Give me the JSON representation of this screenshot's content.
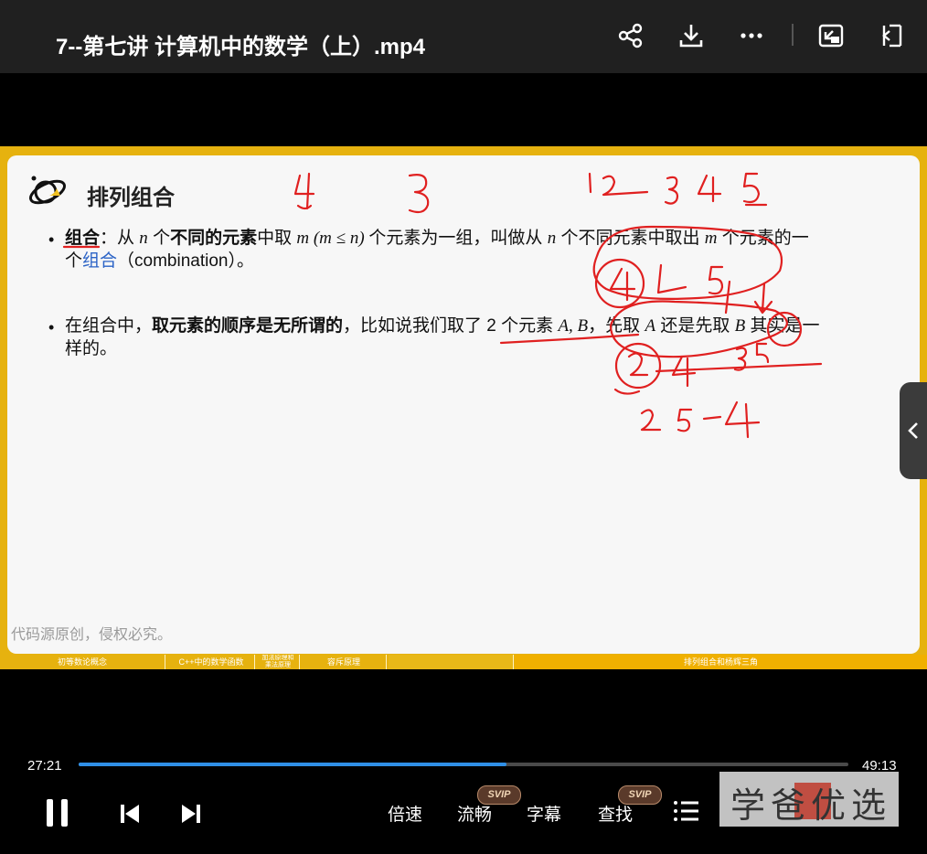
{
  "header": {
    "title": "7--第七讲 计算机中的数学（上）.mp4",
    "icons": [
      "share-icon",
      "download-icon",
      "more-icon",
      "pip-icon",
      "exit-icon"
    ]
  },
  "slide": {
    "heading": "排列组合",
    "bullet1": {
      "term": "组合",
      "t1": "：从 ",
      "n1": "n",
      "t2": " 个",
      "bold1": "不同的元素",
      "t3": "中取 ",
      "m1": "m",
      "cond": " (m ≤ n) ",
      "t4": "个元素为一组，叫做从 ",
      "n2": "n",
      "t5": " 个不同元素中取出 ",
      "m2": "m",
      "t6": " 个元素的一",
      "t7": "个",
      "blue": "组合",
      "t8": "（combination）。"
    },
    "bullet2": {
      "t1": "在组合中，",
      "bold": "取元素的顺序是无所谓的",
      "t2": "，比如说我们取了 2 个元素 ",
      "ab": "A, B",
      "t3": "，先取 ",
      "a": "A",
      "t4": " 还是先取 ",
      "b": "B",
      "t5": " 其实是一",
      "t6": "样的。"
    },
    "watermark": "代码源原创，侵权必究。"
  },
  "chapters": [
    {
      "label": "初等数论概念"
    },
    {
      "label": "C++中的数学函数"
    },
    {
      "label": "加法原理和\n乘法原理"
    },
    {
      "label": "容斥原理"
    },
    {
      "label": ""
    },
    {
      "label": "排列组合和杨辉三角"
    }
  ],
  "playback": {
    "current_time": "27:21",
    "total_time": "49:13",
    "progress_fraction": 0.556
  },
  "controls": {
    "speed": "倍速",
    "quality": "流畅",
    "subtitle": "字幕",
    "search": "查找",
    "svip_badge": "SVIP"
  },
  "brand": {
    "text": "学爸优选"
  },
  "colors": {
    "accent_yellow": "#e6b20f",
    "progress_blue": "#2f8fe6",
    "ink_red": "#e02020"
  }
}
